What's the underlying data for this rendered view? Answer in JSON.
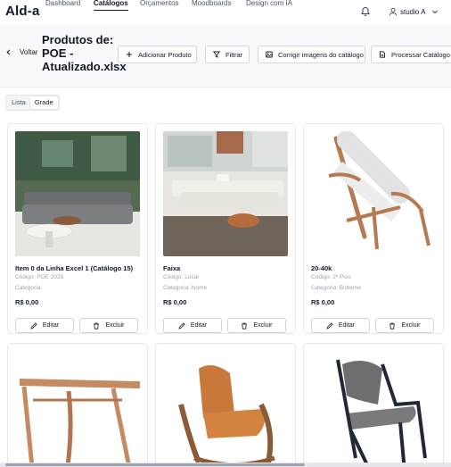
{
  "app": {
    "logo": "Ald-a"
  },
  "nav": {
    "links": [
      "Dashboard",
      "Catálogos",
      "Orçamentos",
      "Moodboards",
      "Design com IA"
    ],
    "active": "Catálogos",
    "user": "studio A"
  },
  "header": {
    "back_label": "Voltar",
    "title": "Produtos de: POE - Atualizado.xlsx",
    "buttons": {
      "add": "Adicionar Produto",
      "filter": "Filtrar",
      "fix_images": "Corrigir imagens do catálogo",
      "process": "Processar Catálogo Completo"
    }
  },
  "view_toggle": {
    "list": "Lista",
    "grid": "Grade",
    "selected": "Grade"
  },
  "products": [
    {
      "name": "Item 0 da Linha Excel 1 (Catálogo 15)",
      "code": "Código: POE 2025",
      "category": "Categoria:",
      "price": "R$ 0,00",
      "image": "sofa-living-room"
    },
    {
      "name": "Faixa",
      "code": "Código: Local",
      "category": "Categoria: Nome",
      "price": "R$ 0,00",
      "image": "white-sofa-room"
    },
    {
      "name": "20-40k",
      "code": "Código: 2º Piso",
      "category": "Categoria: Boheme",
      "price": "R$ 0,00",
      "image": "wood-rope-chair"
    },
    {
      "image": "wood-side-table"
    },
    {
      "image": "leather-armchair"
    },
    {
      "image": "black-armchair"
    }
  ],
  "card_actions": {
    "edit": "Editar",
    "delete": "Excluir"
  },
  "colors": {
    "border": "#e5e7eb",
    "header_bg": "#f8f9fa",
    "text": "#111827",
    "muted": "#9ca3af"
  }
}
